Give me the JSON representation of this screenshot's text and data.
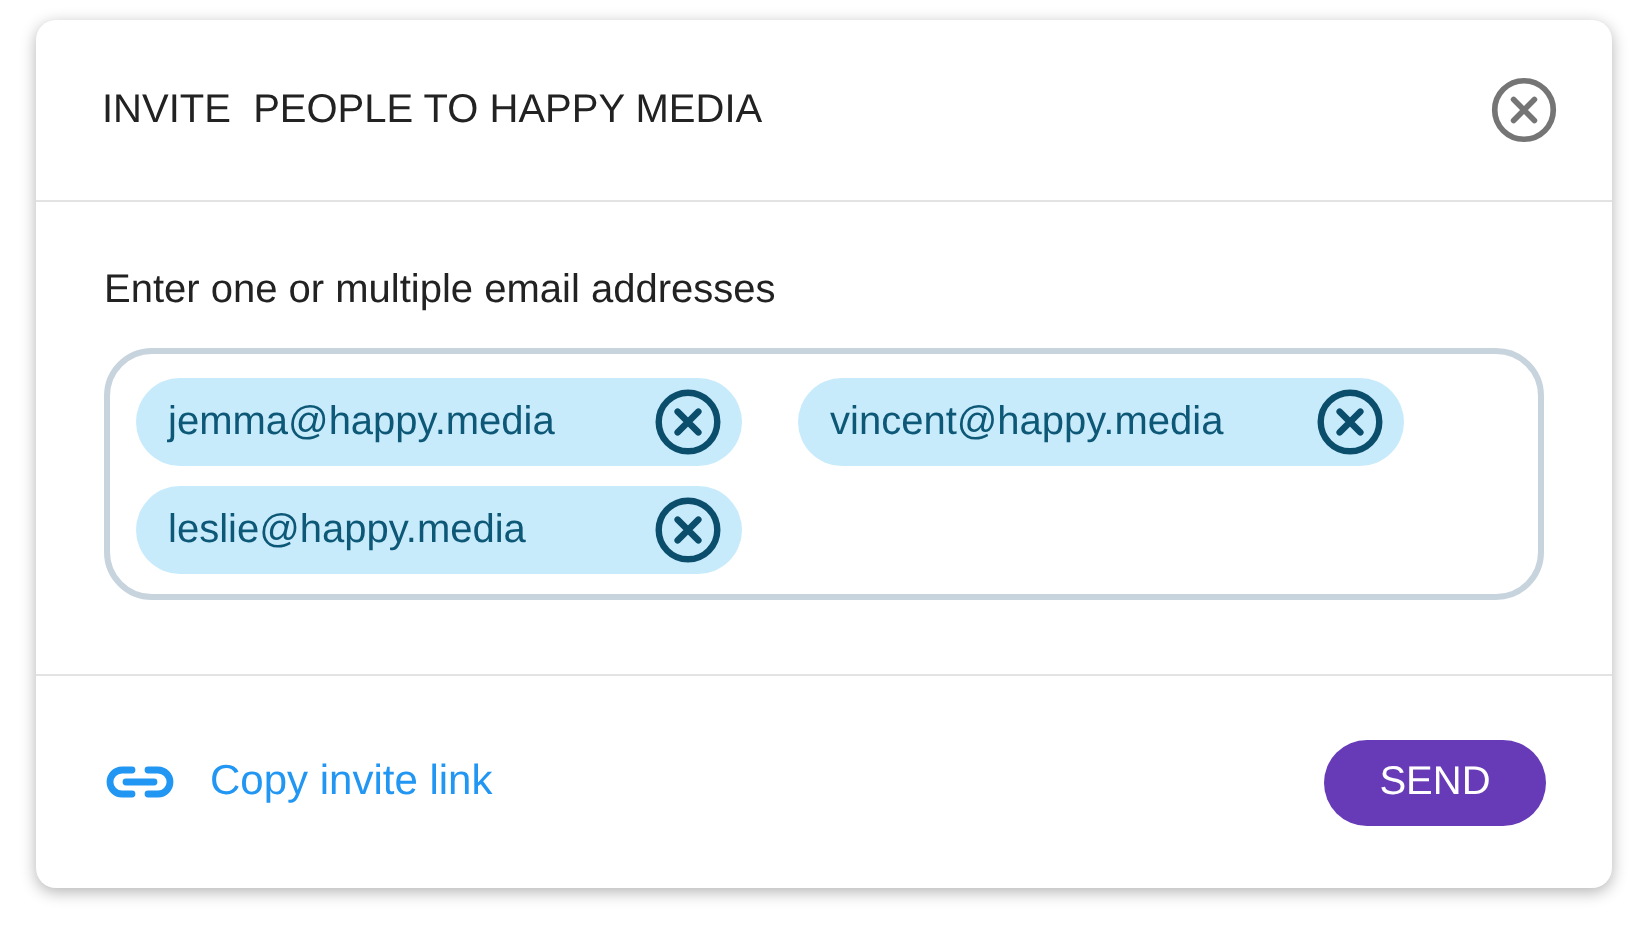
{
  "dialog": {
    "title": "INVITE  PEOPLE TO HAPPY MEDIA"
  },
  "field": {
    "label": "Enter one or multiple email addresses",
    "emails": [
      {
        "address": "jemma@happy.media"
      },
      {
        "address": "vincent@happy.media"
      },
      {
        "address": "leslie@happy.media"
      }
    ]
  },
  "footer": {
    "link": "Copy invite link",
    "button": "SEND"
  }
}
